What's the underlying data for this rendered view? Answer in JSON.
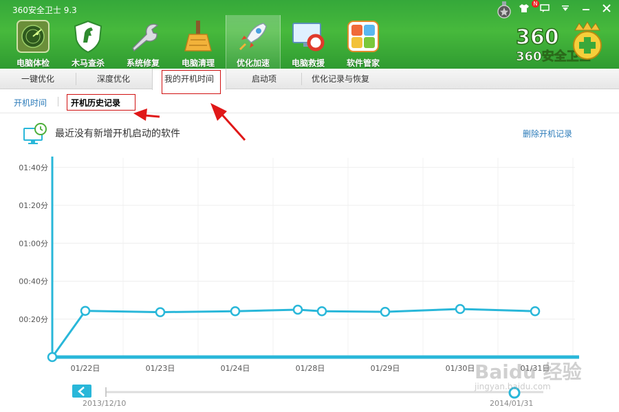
{
  "window": {
    "title": "360安全卫士 9.3",
    "skin_badge": "N"
  },
  "nav": [
    {
      "label": "电脑体检",
      "icon": "radar-icon"
    },
    {
      "label": "木马查杀",
      "icon": "horse-shield-icon"
    },
    {
      "label": "系统修复",
      "icon": "wrench-icon"
    },
    {
      "label": "电脑清理",
      "icon": "broom-icon"
    },
    {
      "label": "优化加速",
      "icon": "rocket-icon"
    },
    {
      "label": "电脑救援",
      "icon": "lifebuoy-monitor-icon"
    },
    {
      "label": "软件管家",
      "icon": "app-grid-icon"
    }
  ],
  "brand": {
    "text": "360安全卫士"
  },
  "subtabs": [
    "一键优化",
    "深度优化",
    "我的开机时间",
    "启动项",
    "优化记录与恢复"
  ],
  "sublinks": {
    "boot_time": "开机时间",
    "boot_history": "开机历史记录"
  },
  "info": {
    "message": "最近没有新增开机启动的软件",
    "delete_link": "删除开机记录"
  },
  "chart_data": {
    "type": "line",
    "y_ticks": [
      "01:40分",
      "01:20分",
      "01:00分",
      "00:40分",
      "00:20分"
    ],
    "y_tick_values": [
      100,
      80,
      60,
      40,
      20
    ],
    "ylim": [
      0,
      105
    ],
    "x_tick_labels": [
      "01/22日",
      "01/23日",
      "01/24日",
      "01/28日",
      "01/29日",
      "01/30日",
      "01/31日"
    ],
    "series": [
      {
        "color": "#29b7d9",
        "x": [
          "",
          "01/22日",
          "01/23日",
          "01/24日",
          "",
          "01/28日",
          "01/29日",
          "01/30日",
          "01/31日"
        ],
        "values_seconds": [
          0,
          1461,
          1421,
          1451,
          1500,
          1451,
          1431,
          1520,
          1451
        ]
      }
    ],
    "grid": true
  },
  "slider": {
    "start_label": "2013/12/10",
    "end_label": "2014/01/31",
    "prev_icon": "chevron-left-icon"
  },
  "colors": {
    "header_green": "#3aaa3a",
    "accent_blue": "#29b7d9",
    "link_blue": "#2b7bb9",
    "annotation_red": "#d01010"
  }
}
